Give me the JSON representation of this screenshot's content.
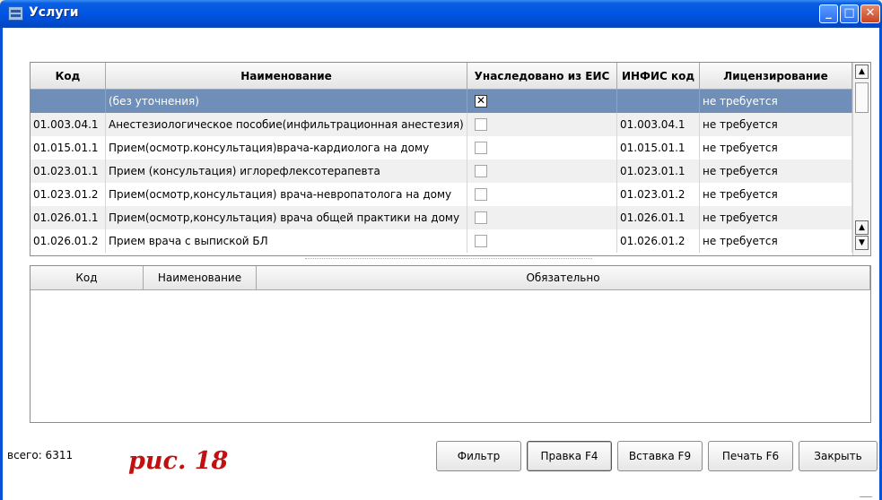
{
  "window": {
    "title": "Услуги"
  },
  "services_table": {
    "columns": [
      "Код",
      "Наименование",
      "Унаследовано из ЕИС",
      "ИНФИС код",
      "Лицензирование"
    ],
    "rows": [
      {
        "code": "",
        "name": "(без уточнения)",
        "inherited": true,
        "infis": "",
        "license": "не требуется",
        "selected": true
      },
      {
        "code": "01.003.04.1",
        "name": "Анестезиологическое пособие(инфильтрационная анестезия)",
        "inherited": false,
        "infis": "01.003.04.1",
        "license": "не требуется"
      },
      {
        "code": "01.015.01.1",
        "name": "Прием(осмотр.консультация)врача-кардиолога на дому",
        "inherited": false,
        "infis": "01.015.01.1",
        "license": "не требуется"
      },
      {
        "code": "01.023.01.1",
        "name": "Прием (консультация) иглорефлексотерапевта",
        "inherited": false,
        "infis": "01.023.01.1",
        "license": "не требуется"
      },
      {
        "code": "01.023.01.2",
        "name": "Прием(осмотр,консультация) врача-невропатолога на дому",
        "inherited": false,
        "infis": "01.023.01.2",
        "license": "не требуется"
      },
      {
        "code": "01.026.01.1",
        "name": "Прием(осмотр,консультация) врача общей практики на дому",
        "inherited": false,
        "infis": "01.026.01.1",
        "license": "не требуется"
      },
      {
        "code": "01.026.01.2",
        "name": "Прием врача с выпиской БЛ",
        "inherited": false,
        "infis": "01.026.01.2",
        "license": "не требуется"
      }
    ]
  },
  "details_table": {
    "columns": [
      "Код",
      "Наименование",
      "Обязательно"
    ]
  },
  "status": {
    "total": "всего: 6311"
  },
  "caption": "рис. 18",
  "buttons": {
    "filter": "Фильтр",
    "edit": "Правка F4",
    "insert": "Вставка F9",
    "print": "Печать F6",
    "close": "Закрыть"
  },
  "icons": {
    "window_icon": "app-window-icon",
    "minimize": "minimize-icon",
    "maximize": "maximize-icon",
    "close": "close-icon"
  },
  "colors": {
    "title_bar": "#0054e3",
    "selected_row": "#6f8fb8",
    "caption": "#c01010"
  }
}
